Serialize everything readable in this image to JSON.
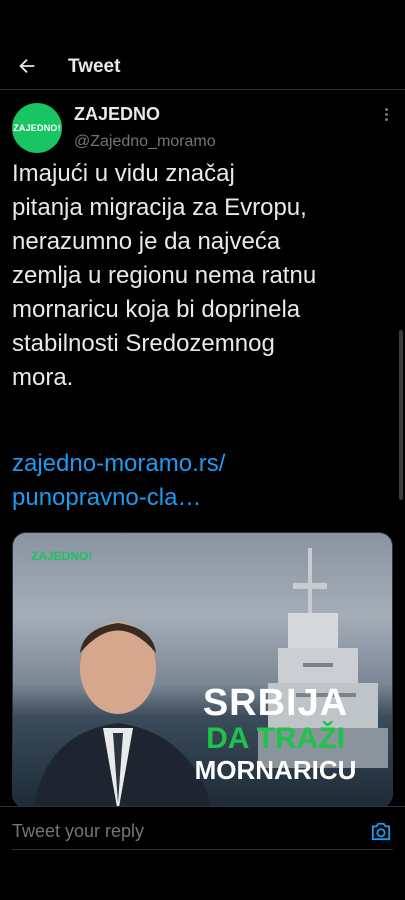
{
  "header": {
    "title": "Tweet",
    "back_icon": "arrow-left-icon"
  },
  "tweet": {
    "author_name": "ZAJEDNO",
    "author_handle": "@Zajedno_moramo",
    "avatar_text": "ZAJEDNO!",
    "text": "Imajući u vidu značaj\npitanja migracija za Evropu,\nnerazumno je da najveća\nzemlja u regionu nema ratnu\nmornaricu koja bi doprinela\nstabilnosti Sredozemnog\nmora.",
    "link": "zajedno-moramo.rs/\npunopravno-cla…",
    "media": {
      "logo": "ZAJEDNO!",
      "line1": "SRBIJA",
      "line2": "DA TRAŽI",
      "line3": "MORNARICU"
    }
  },
  "reply": {
    "placeholder": "Tweet your reply",
    "camera_icon": "camera-icon"
  },
  "colors": {
    "accent": "#1d9bf0",
    "brand_green": "#19c463",
    "background": "#000000"
  }
}
